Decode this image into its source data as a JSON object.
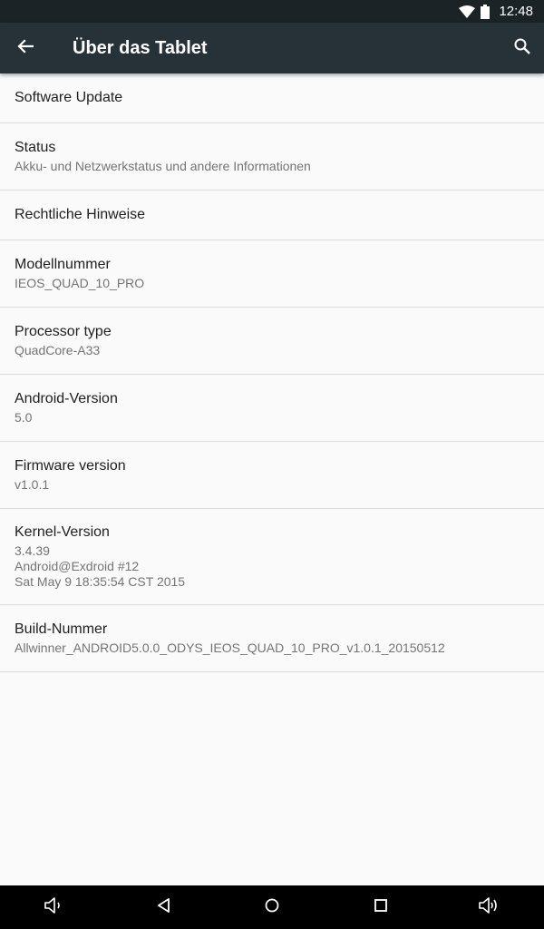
{
  "status_bar": {
    "time": "12:48"
  },
  "app_bar": {
    "title": "Über das Tablet"
  },
  "items": [
    {
      "title": "Software Update"
    },
    {
      "title": "Status",
      "summary": "Akku- und Netzwerkstatus und andere Informationen"
    },
    {
      "title": "Rechtliche Hinweise"
    },
    {
      "title": "Modellnummer",
      "summary": "IEOS_QUAD_10_PRO"
    },
    {
      "title": "Processor type",
      "summary": "QuadCore-A33"
    },
    {
      "title": "Android-Version",
      "summary": "5.0"
    },
    {
      "title": "Firmware version",
      "summary": "v1.0.1"
    },
    {
      "title": "Kernel-Version",
      "summary": "3.4.39\nAndroid@Exdroid #12\nSat May 9 18:35:54 CST 2015"
    },
    {
      "title": "Build-Nummer",
      "summary": "Allwinner_ANDROID5.0.0_ODYS_IEOS_QUAD_10_PRO_v1.0.1_20150512"
    }
  ],
  "colors": {
    "app_bar": "#263238",
    "status_bar": "#1c2327",
    "nav_bar": "#000000",
    "background": "#fafafa"
  }
}
